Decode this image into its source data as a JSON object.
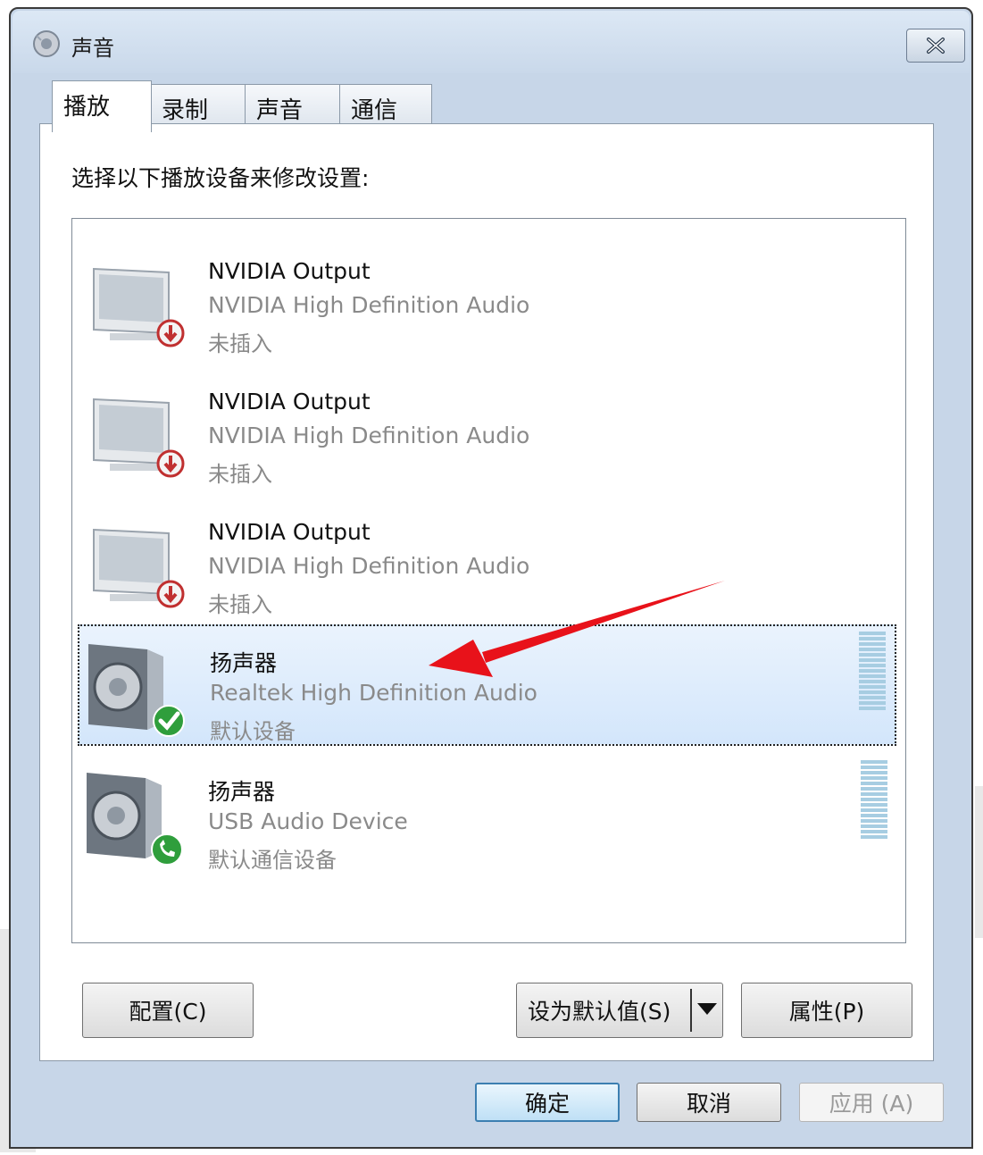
{
  "window": {
    "title": "声音"
  },
  "tabs": [
    {
      "label": "播放",
      "active": true
    },
    {
      "label": "录制",
      "active": false
    },
    {
      "label": "声音",
      "active": false
    },
    {
      "label": "通信",
      "active": false
    }
  ],
  "playback": {
    "instruction": "选择以下播放设备来修改设置:",
    "devices": [
      {
        "name": "NVIDIA Output",
        "desc": "NVIDIA High Definition Audio",
        "status": "未插入",
        "icon": "monitor-icon",
        "badge": "unplugged-icon"
      },
      {
        "name": "NVIDIA Output",
        "desc": "NVIDIA High Definition Audio",
        "status": "未插入",
        "icon": "monitor-icon",
        "badge": "unplugged-icon"
      },
      {
        "name": "NVIDIA Output",
        "desc": "NVIDIA High Definition Audio",
        "status": "未插入",
        "icon": "monitor-icon",
        "badge": "unplugged-icon"
      },
      {
        "name": "扬声器",
        "desc": "Realtek High Definition Audio",
        "status": "默认设备",
        "icon": "speaker-icon",
        "badge": "checkmark-icon",
        "selected": true
      },
      {
        "name": "扬声器",
        "desc": "USB Audio Device",
        "status": "默认通信设备",
        "icon": "speaker-icon",
        "badge": "phone-icon"
      }
    ],
    "buttons": {
      "configure": "配置(C)",
      "set_default": "设为默认值(S)",
      "properties": "属性(P)"
    }
  },
  "footer": {
    "ok": "确定",
    "cancel": "取消",
    "apply": "应用 (A)"
  },
  "colors": {
    "selection": "#d3e6fb",
    "annotation_arrow": "#e8121a",
    "default_button_border": "#3c7fb1"
  }
}
